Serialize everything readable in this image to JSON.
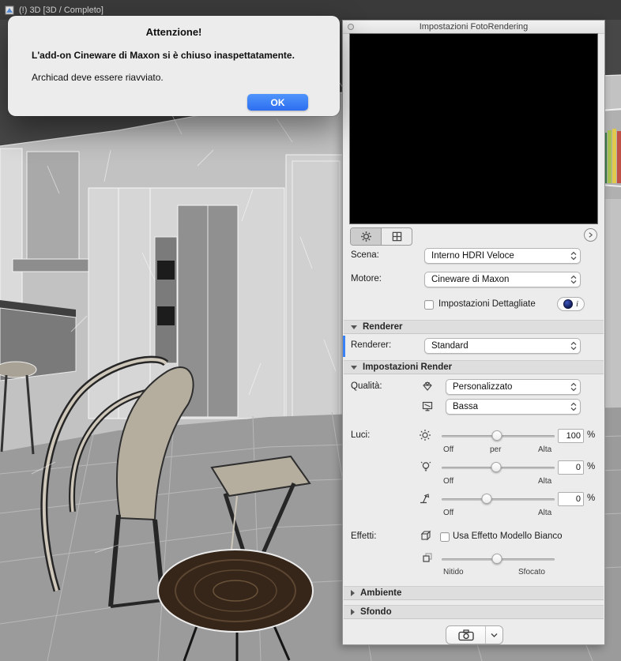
{
  "topbar": {
    "tab_label": "(!) 3D [3D / Completo]"
  },
  "alert": {
    "title": "Attenzione!",
    "line1": "L'add-on Cineware di Maxon si è chiuso inaspettatamente.",
    "line2": "Archicad deve essere riavviato.",
    "ok": "OK"
  },
  "panel": {
    "title": "Impostazioni FotoRendering",
    "rows": {
      "scena": {
        "label": "Scena:",
        "value": "Interno HDRI Veloce"
      },
      "motore": {
        "label": "Motore:",
        "value": "Cineware di Maxon"
      },
      "dettagliate": {
        "label": "Impostazioni Dettagliate",
        "checked": false,
        "info": "i"
      },
      "renderer": {
        "label": "Renderer:",
        "value": "Standard"
      },
      "qualita": {
        "label": "Qualità:",
        "value": "Personalizzato"
      },
      "qualita2": {
        "value": "Bassa"
      },
      "luci": {
        "label": "Luci:"
      },
      "effetti": {
        "label": "Effetti:",
        "checkbox_label": "Usa Effetto Modello Bianco",
        "checked": false
      }
    },
    "sections": {
      "renderer": "Renderer",
      "impostazioni_render": "Impostazioni Render",
      "ambiente": "Ambiente",
      "sfondo": "Sfondo"
    },
    "sliders": [
      {
        "value": "100",
        "unit": "%",
        "pos": 49,
        "ticks": [
          "Off",
          "per",
          "Alta"
        ]
      },
      {
        "value": "0",
        "unit": "%",
        "pos": 48,
        "ticks": [
          "Off",
          "Alta"
        ]
      },
      {
        "value": "0",
        "unit": "%",
        "pos": 40,
        "ticks": [
          "Off",
          "Alta"
        ]
      },
      {
        "pos": 49,
        "ticks": [
          "Nitido",
          "Sfocato"
        ]
      }
    ]
  },
  "icons": [
    "gear-icon",
    "grid-icon",
    "chevron-right-icon",
    "cinema4d-ball-icon",
    "info-icon",
    "diamond-quality-icon",
    "display-icon",
    "sun-icon",
    "bulb-icon",
    "lamp-icon",
    "cube-icon",
    "blur-icon",
    "camera-icon",
    "chevron-down-icon"
  ],
  "colors": {
    "ok_blue": "#2f7bf3",
    "c4d_navy": "#131f59",
    "panel_gray": "#ececec",
    "topbar_gray": "#3a3a3a"
  }
}
